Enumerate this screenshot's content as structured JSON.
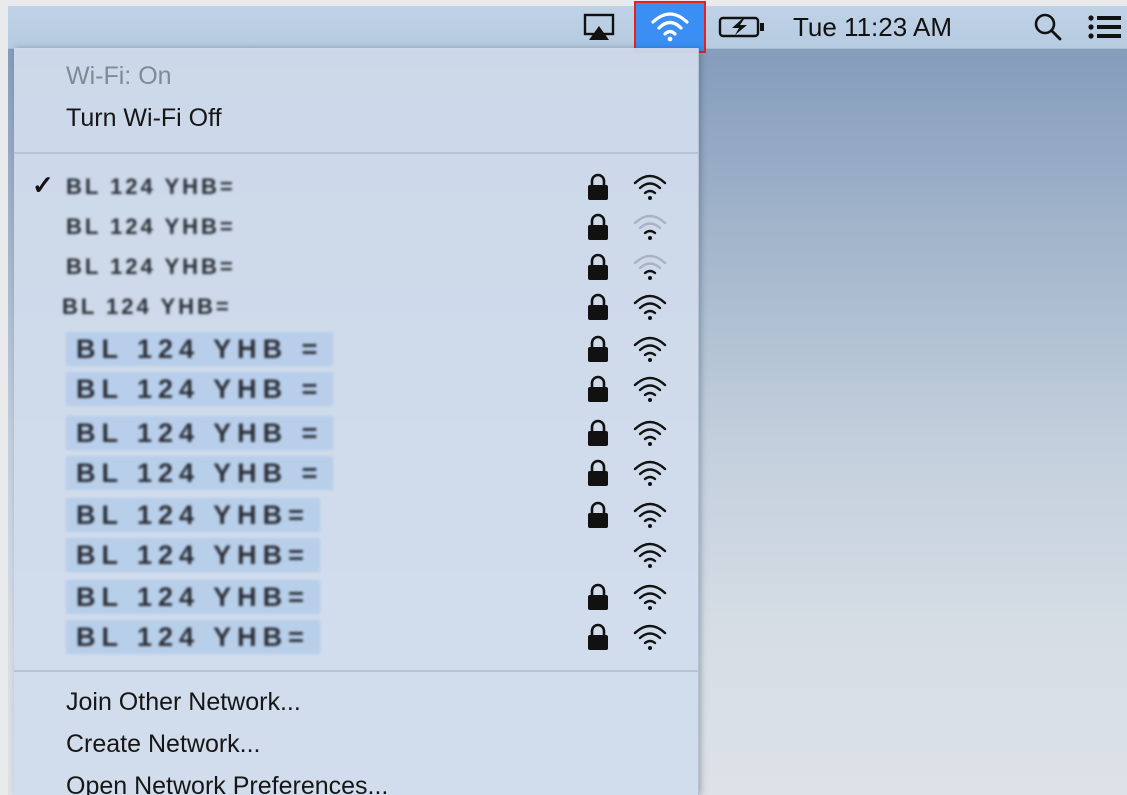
{
  "menubar": {
    "clock": "Tue 11:23 AM",
    "icons": [
      "airplay-icon",
      "wifi-icon",
      "battery-charging-icon",
      "search-icon",
      "notification-list-icon"
    ],
    "highlight_color": "#3a8ef4",
    "annotation_color": "#e8211d"
  },
  "wifi_menu": {
    "status": "Wi-Fi: On",
    "toggle_label": "Turn Wi-Fi Off",
    "networks": [
      {
        "name": "BL 124 YHB=",
        "connected": true,
        "locked": true,
        "signal": "full"
      },
      {
        "name": "BL 124 YHB=",
        "connected": false,
        "locked": true,
        "signal": "weak"
      },
      {
        "name": "BL 124 YHB=",
        "connected": false,
        "locked": true,
        "signal": "weak"
      },
      {
        "name": "BL 124 YHB=",
        "connected": false,
        "locked": true,
        "signal": "full"
      },
      {
        "name": "BL 124 YHB =",
        "connected": false,
        "locked": true,
        "signal": "full"
      },
      {
        "name": "BL 124 YHB =",
        "connected": false,
        "locked": true,
        "signal": "full"
      },
      {
        "name": "BL 124 YHB =",
        "connected": false,
        "locked": true,
        "signal": "full"
      },
      {
        "name": "BL 124 YHB =",
        "connected": false,
        "locked": true,
        "signal": "full"
      },
      {
        "name": "BL 124 YHB=",
        "connected": false,
        "locked": true,
        "signal": "full"
      },
      {
        "name": "BL 124 YHB=",
        "connected": false,
        "locked": false,
        "signal": "full"
      },
      {
        "name": "BL 124 YHB=",
        "connected": false,
        "locked": true,
        "signal": "full"
      },
      {
        "name": "BL 124 YHB=",
        "connected": false,
        "locked": true,
        "signal": "full"
      }
    ],
    "join_other": "Join Other Network...",
    "create_network": "Create Network...",
    "open_prefs": "Open Network Preferences..."
  }
}
